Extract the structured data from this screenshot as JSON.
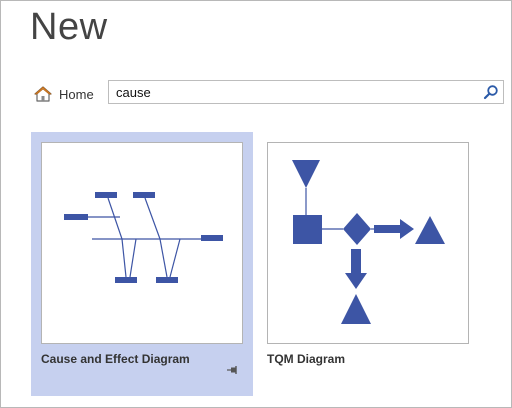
{
  "page": {
    "title": "New"
  },
  "nav": {
    "home_label": "Home",
    "home_icon": "home-icon"
  },
  "search": {
    "value": "cause",
    "icon": "search-icon"
  },
  "colors": {
    "accent": "#3d55a5",
    "selection": "#c6d0ef"
  },
  "templates": [
    {
      "label": "Cause and Effect Diagram",
      "selected": true,
      "pinnable": true
    },
    {
      "label": "TQM Diagram",
      "selected": false,
      "pinnable": false
    }
  ]
}
